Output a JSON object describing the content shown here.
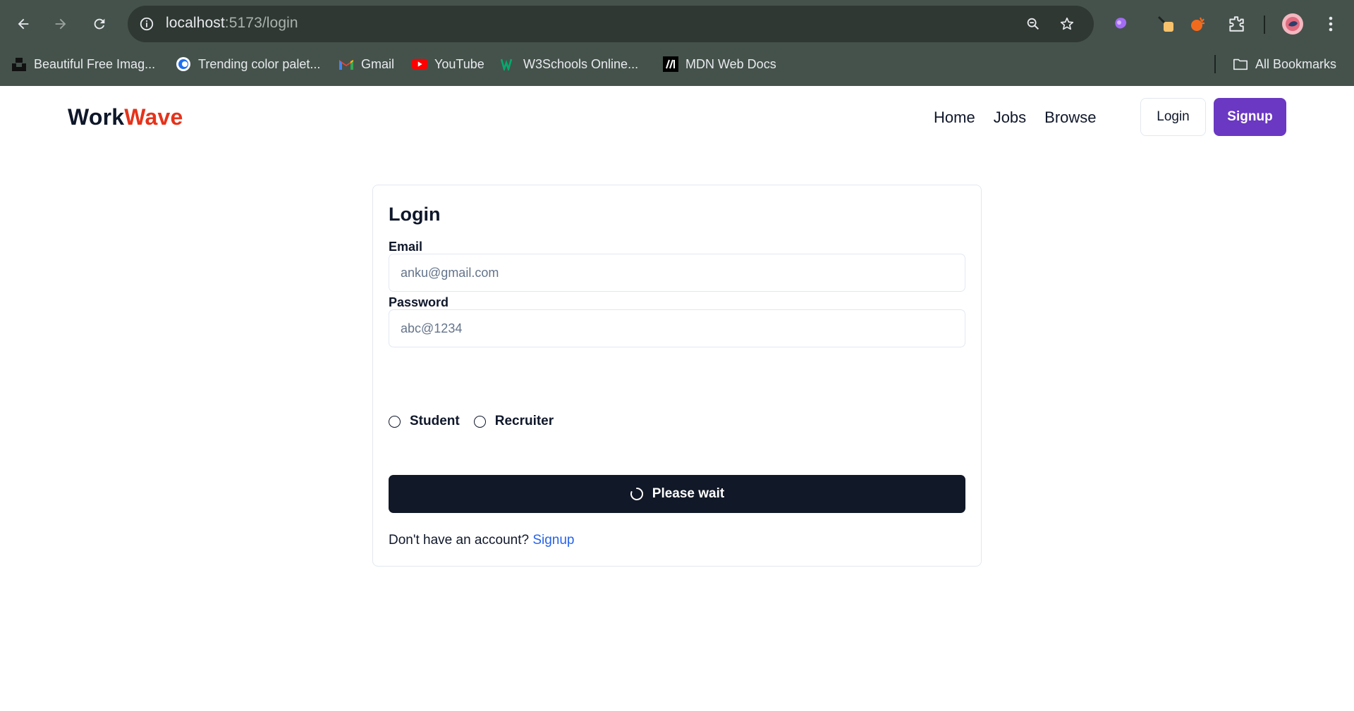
{
  "browser": {
    "url_host": "localhost",
    "url_path": ":5173/login",
    "bookmarks": [
      {
        "label": "Beautiful Free Imag...",
        "icon": "unsplash-icon"
      },
      {
        "label": "Trending color palet...",
        "icon": "coolors-icon"
      },
      {
        "label": "Gmail",
        "icon": "gmail-icon"
      },
      {
        "label": "YouTube",
        "icon": "youtube-icon"
      },
      {
        "label": "W3Schools Online...",
        "icon": "w3schools-icon"
      },
      {
        "label": "MDN Web Docs",
        "icon": "mdn-icon"
      }
    ],
    "all_bookmarks_label": "All Bookmarks"
  },
  "navbar": {
    "logo_part1": "Work",
    "logo_part2": "Wave",
    "links": [
      "Home",
      "Jobs",
      "Browse"
    ],
    "login_label": "Login",
    "signup_label": "Signup"
  },
  "form": {
    "title": "Login",
    "email_label": "Email",
    "email_placeholder": "anku@gmail.com",
    "password_label": "Password",
    "password_placeholder": "abc@1234",
    "roles": [
      "Student",
      "Recruiter"
    ],
    "submit_label": "Please wait",
    "footer_text": "Don't have an account?",
    "footer_link": "Signup"
  },
  "colors": {
    "chrome_bg": "#45524c",
    "brand_accent": "#e5331b",
    "signup_bg": "#6a38c2",
    "submit_bg": "#111827",
    "link": "#2563eb"
  }
}
